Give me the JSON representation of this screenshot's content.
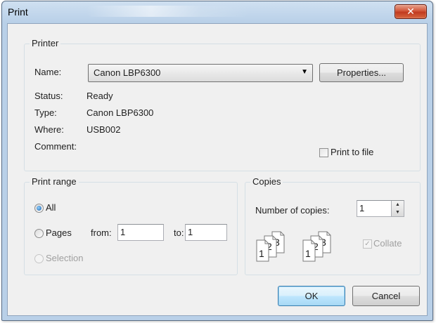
{
  "window": {
    "title": "Print",
    "close_glyph": "✕"
  },
  "printer": {
    "group_label": "Printer",
    "name_label": "Name:",
    "name_value": "Canon LBP6300",
    "properties_button": "Properties...",
    "status_label": "Status:",
    "status_value": "Ready",
    "type_label": "Type:",
    "type_value": "Canon LBP6300",
    "where_label": "Where:",
    "where_value": "USB002",
    "comment_label": "Comment:",
    "comment_value": "",
    "print_to_file_label": "Print to file",
    "print_to_file_checked": false
  },
  "print_range": {
    "group_label": "Print range",
    "all_label": "All",
    "pages_label": "Pages",
    "from_label": "from:",
    "from_value": "1",
    "to_label": "to:",
    "to_value": "1",
    "selection_label": "Selection",
    "selected": "All"
  },
  "copies": {
    "group_label": "Copies",
    "number_label": "Number of copies:",
    "number_value": "1",
    "collate_label": "Collate",
    "collate_checked": true,
    "collate_enabled": false,
    "page_numbers": [
      "1",
      "2",
      "3"
    ]
  },
  "buttons": {
    "ok": "OK",
    "cancel": "Cancel"
  },
  "colors": {
    "title_bar": "#b9d0e8",
    "close_button": "#c13a1f",
    "dialog_background": "#f0f0f0",
    "default_button_border": "#3c7fb1"
  },
  "icons": [
    "close-icon",
    "dropdown-arrow-icon",
    "spin-up-icon",
    "spin-down-icon",
    "collate-pages-icon",
    "checkmark-icon"
  ]
}
